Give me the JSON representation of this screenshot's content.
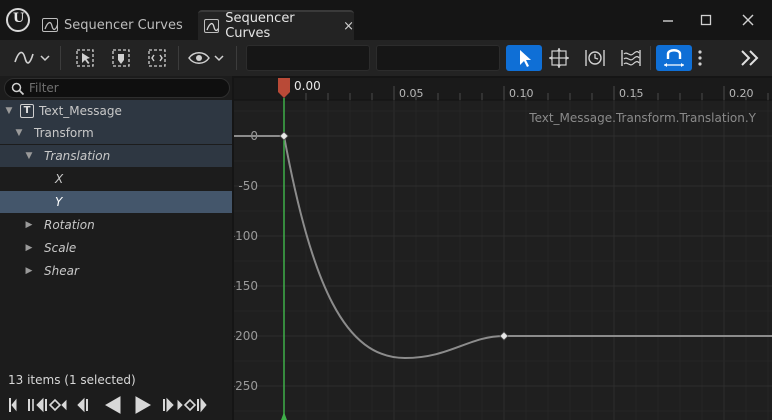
{
  "window": {
    "tabs": [
      {
        "label": "Sequencer Curves",
        "active": false
      },
      {
        "label": "Sequencer Curves",
        "active": true
      }
    ],
    "close_glyph": "×",
    "minimize_glyph": "—",
    "maximize_glyph": "☐",
    "window_close_glyph": "✕"
  },
  "toolbar": {
    "icons": [
      "curve-mode-icon",
      "select-cursor-icon",
      "key-tangent-icon",
      "frame-icon",
      "eye-icon",
      "pointer-icon",
      "transform-icon",
      "retime-icon",
      "lattice-icon",
      "magnet-icon",
      "more-icon"
    ],
    "overflow_glyph": "»",
    "accent": "#0f6fd6"
  },
  "outliner": {
    "search_placeholder": "Filter",
    "items": [
      {
        "label": "Text_Message",
        "depth": 0,
        "expanded": true,
        "italic": false
      },
      {
        "label": "Transform",
        "depth": 1,
        "expanded": true,
        "italic": false
      },
      {
        "label": "Translation",
        "depth": 2,
        "expanded": true,
        "italic": true
      },
      {
        "label": "X",
        "depth": 3,
        "italic": true
      },
      {
        "label": "Y",
        "depth": 3,
        "italic": true,
        "selected": true
      },
      {
        "label": "Rotation",
        "depth": 2,
        "expanded": false,
        "italic": true
      },
      {
        "label": "Scale",
        "depth": 2,
        "expanded": false,
        "italic": true
      },
      {
        "label": "Shear",
        "depth": 2,
        "expanded": false,
        "italic": true
      }
    ],
    "status": "13 items (1 selected)"
  },
  "curve_editor": {
    "playhead_label": "0.00",
    "time_ticks": [
      "0.05",
      "0.10",
      "0.15",
      "0.20"
    ],
    "time_tick_values": [
      0.05,
      0.1,
      0.15,
      0.2
    ],
    "value_ticks": [
      "0",
      "-50",
      "-100",
      "-150",
      "-200",
      "-250"
    ],
    "value_tick_values": [
      0,
      -50,
      -100,
      -150,
      -200,
      -250
    ],
    "curve_label": "Text_Message.Transform.Translation.Y",
    "keys": [
      {
        "time": 0.0,
        "value": 0
      },
      {
        "time": 0.1,
        "value": -200
      }
    ],
    "curve_min": {
      "time": 0.055,
      "value": -222
    }
  }
}
